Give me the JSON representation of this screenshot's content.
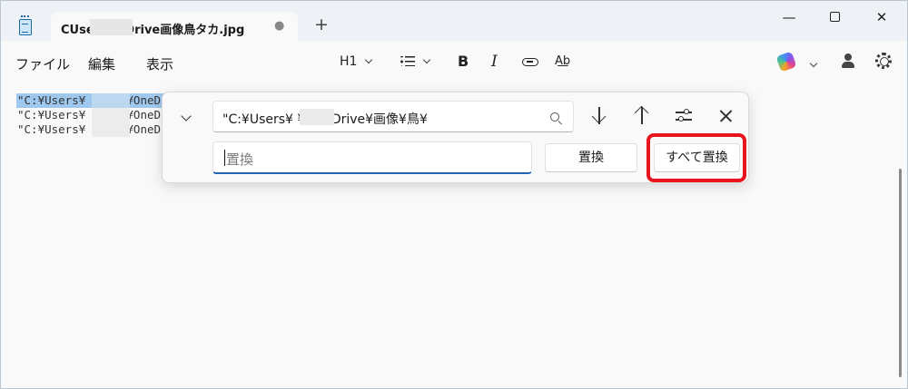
{
  "titlebar": {
    "tab_title": "CUse          OneDrive画像鳥タカ.jpg",
    "tab_close_glyph": "●",
    "new_tab_glyph": "+",
    "minimize_glyph": "—",
    "close_glyph": "✕"
  },
  "menu": {
    "file": "ファイル",
    "edit": "編集",
    "view": "表示"
  },
  "toolbar": {
    "heading": "H1",
    "bold": "B",
    "italic": "I",
    "spellcheck": "A͟b"
  },
  "editor": {
    "lines": [
      "\"C:¥Users¥      ¥OneD",
      "\"C:¥Users¥      ¥OneD",
      "\"C:¥Users¥      ¥OneD"
    ]
  },
  "find_panel": {
    "find_value": "\"C:¥Users¥          ¥OneDrive¥画像¥鳥¥",
    "replace_placeholder": "置換",
    "replace_button": "置換",
    "replace_all_button": "すべて置換"
  },
  "colors": {
    "highlight": "#e8141d",
    "selection": "#9fc8ee",
    "accent": "#1f65b3"
  }
}
